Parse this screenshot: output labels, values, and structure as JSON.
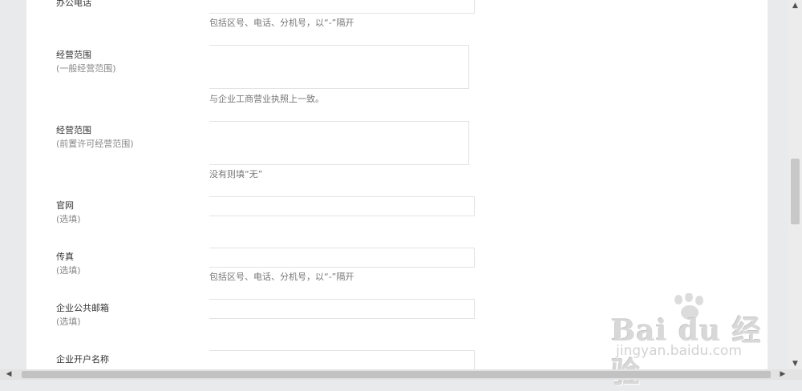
{
  "form": {
    "office_phone": {
      "label": "办公电话",
      "hint": "包括区号、电话、分机号，以“-”隔开"
    },
    "scope_general": {
      "label": "经营范围",
      "sub": "(一般经营范围)",
      "hint": "与企业工商营业执照上一致。"
    },
    "scope_licensed": {
      "label": "经营范围",
      "sub": "(前置许可经营范围)",
      "hint": "没有则填“无”"
    },
    "website": {
      "label": "官网",
      "sub": "(选填)"
    },
    "fax": {
      "label": "传真",
      "sub": "(选填)",
      "hint": "包括区号、电话、分机号，以“-”隔开"
    },
    "public_email": {
      "label": "企业公共邮箱",
      "sub": "(选填)"
    },
    "account_name": {
      "label": "企业开户名称"
    }
  },
  "watermark": {
    "brand": "Bai du 经验",
    "site": "jingyan.baidu.com"
  },
  "scrollbar": {
    "up": "▲",
    "down": "▼",
    "left": "◀",
    "right": "▶"
  },
  "colors": {
    "page_background": "#e9eaec",
    "panel": "#ffffff",
    "label": "#333333",
    "hint": "#777777",
    "border": "#e3e3e3"
  }
}
